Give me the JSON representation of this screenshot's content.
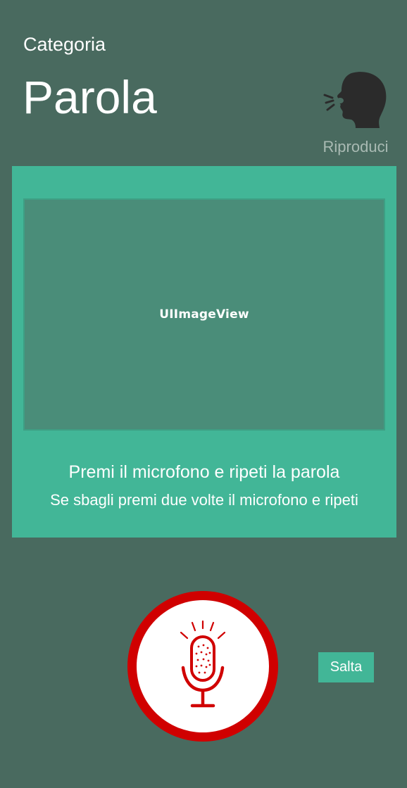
{
  "header": {
    "category_label": "Categoria",
    "word": "Parola",
    "speak_icon": "speaking-head-icon",
    "speak_label": "Riproduci"
  },
  "card": {
    "image_placeholder": "UIImageView",
    "instruction_primary": "Premi il microfono e ripeti la parola",
    "instruction_secondary": "Se sbagli premi due volte il microfono e ripeti"
  },
  "controls": {
    "mic_icon": "microphone-icon",
    "skip_label": "Salta"
  },
  "colors": {
    "background": "#496a5f",
    "card": "#42b697",
    "image_bg": "#4a8d79",
    "mic_red": "#d00000",
    "muted_text": "#a9bab3"
  }
}
